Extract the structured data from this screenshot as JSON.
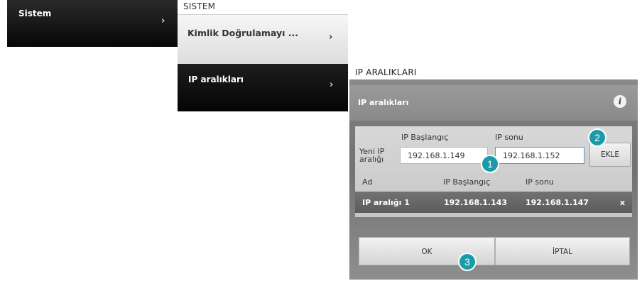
{
  "left_menu": {
    "label": "Sistem",
    "chevron": "›"
  },
  "sistem_panel": {
    "title": "SISTEM",
    "items": [
      {
        "label": "Kimlik Doğrulamayı ...",
        "chevron": "›"
      },
      {
        "label": "IP aralıkları",
        "chevron": "›"
      }
    ]
  },
  "dialog": {
    "title": "IP ARALIKLARI",
    "header_label": "IP aralıkları",
    "info_icon": "i",
    "form": {
      "new_range_label_line1": "Yeni IP",
      "new_range_label_line2": "aralığı",
      "start_label": "IP Başlangıç",
      "end_label": "IP sonu",
      "start_value": "192.168.1.149",
      "end_value": "192.168.1.152",
      "add_button": "EKLE"
    },
    "table": {
      "headers": [
        "Ad",
        "IP Başlangıç",
        "IP sonu"
      ],
      "rows": [
        {
          "name": "IP aralığı 1",
          "start": "192.168.1.143",
          "end": "192.168.1.147",
          "delete": "x"
        }
      ]
    },
    "buttons": {
      "ok": "OK",
      "cancel": "İPTAL"
    }
  },
  "badges": [
    "1",
    "2",
    "3"
  ],
  "colors": {
    "badge": "#1a9ba7",
    "focus_border": "#5a8fd6"
  }
}
